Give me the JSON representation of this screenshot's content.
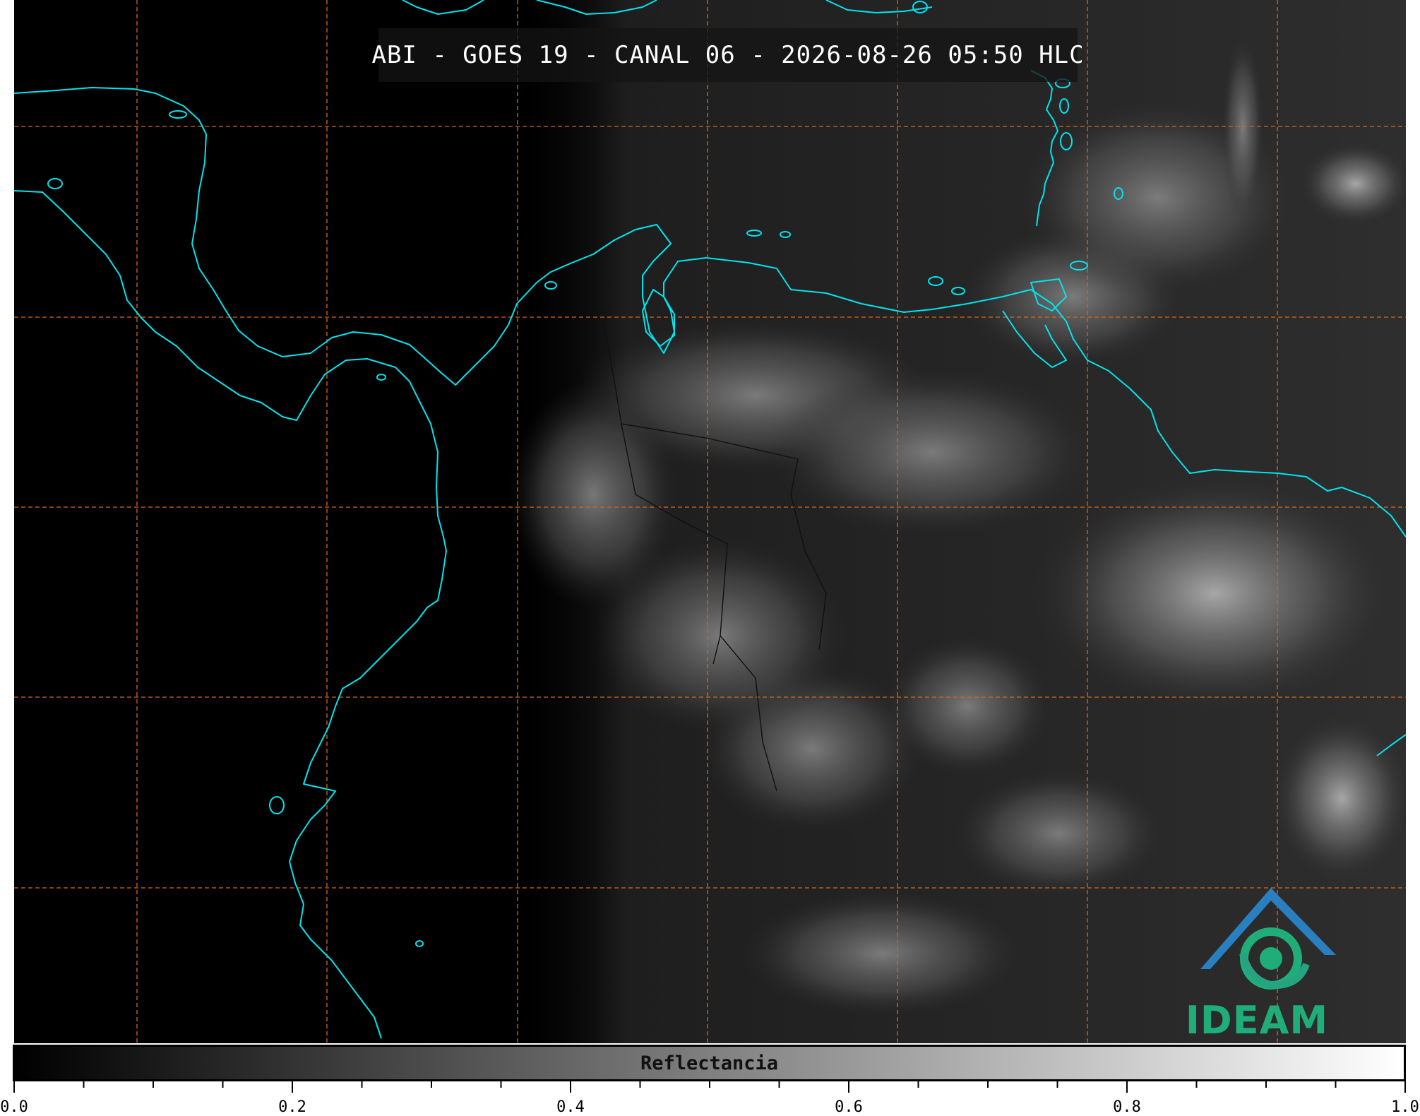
{
  "title": "ABI - GOES 19 - CANAL 06 - 2026-08-26 05:50 HLC",
  "colors": {
    "background": "#000000",
    "coastline": "#00e5ee",
    "gridline": "#d2691e",
    "title_box": "#141414",
    "logo_green": "#1fae7a",
    "logo_blue": "#2a7fc0"
  },
  "logo": {
    "text": "IDEAM",
    "icon": "ideam-logo-icon"
  },
  "colorbar": {
    "label": "Reflectancia",
    "min": 0.0,
    "max": 1.0,
    "colormap": "grayscale",
    "major_ticks": [
      "0.0",
      "0.2",
      "0.4",
      "0.6",
      "0.8",
      "1.0"
    ]
  }
}
